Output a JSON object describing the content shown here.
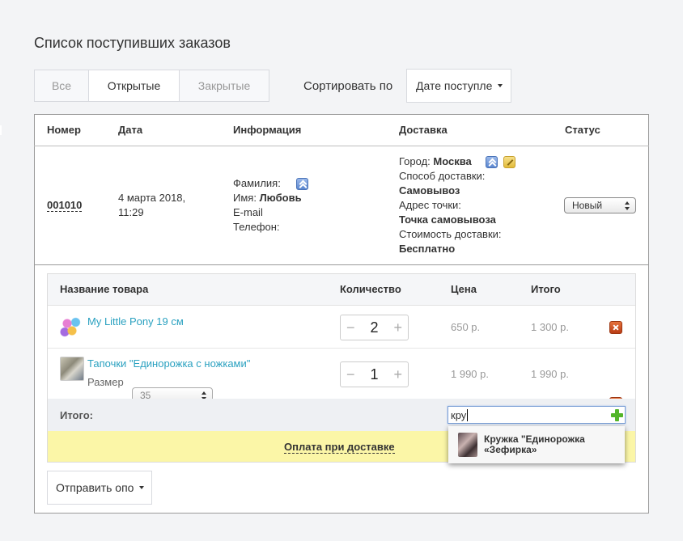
{
  "page_title": "Список поступивших заказов",
  "tabs": [
    {
      "label": "Все"
    },
    {
      "label": "Открытые",
      "active": true
    },
    {
      "label": "Закрытые"
    }
  ],
  "sort": {
    "label": "Сортировать по",
    "value": "Дате поступле"
  },
  "orders_table": {
    "headers": [
      "Номер",
      "Дата",
      "Информация",
      "Доставка",
      "Статус"
    ]
  },
  "order": {
    "number": "001010",
    "date_line1": "4 марта 2018,",
    "date_line2": "11:29",
    "info": {
      "surname_label": "Фамилия:",
      "name_label": "Имя:",
      "name_value": "Любовь",
      "email_label": "E-mail",
      "phone_label": "Телефон:"
    },
    "delivery": {
      "city_label": "Город:",
      "city_value": "Москва",
      "method_label": "Способ доставки:",
      "method_value": "Самовывоз",
      "address_label": "Адрес точки:",
      "address_value": "Точка самовывоза",
      "cost_label": "Стоимость доставки:",
      "cost_value": "Бесплатно"
    },
    "status": "Новый"
  },
  "items_table": {
    "headers": [
      "Название товара",
      "Количество",
      "Цена",
      "Итого"
    ],
    "items": [
      {
        "name": "My Little Pony 19 см",
        "qty": "2",
        "price": "650 р.",
        "total": "1 300 р."
      },
      {
        "name": "Тапочки \"Единорожка с ножками\"",
        "size_label": "Размер",
        "size_value": "35",
        "qty": "1",
        "price": "1 990 р.",
        "total": "1 990 р."
      }
    ],
    "total_label": "Итого:",
    "search_value": "кру",
    "suggestion": "Кружка \"Единорожка «Зефирка»",
    "payment": "Оплата при доставке"
  },
  "send_button": "Отправить опо",
  "icons": {
    "up": "chevrons-up-icon",
    "edit": "pencil-icon",
    "delete": "close-x-icon",
    "add": "plus-icon"
  }
}
